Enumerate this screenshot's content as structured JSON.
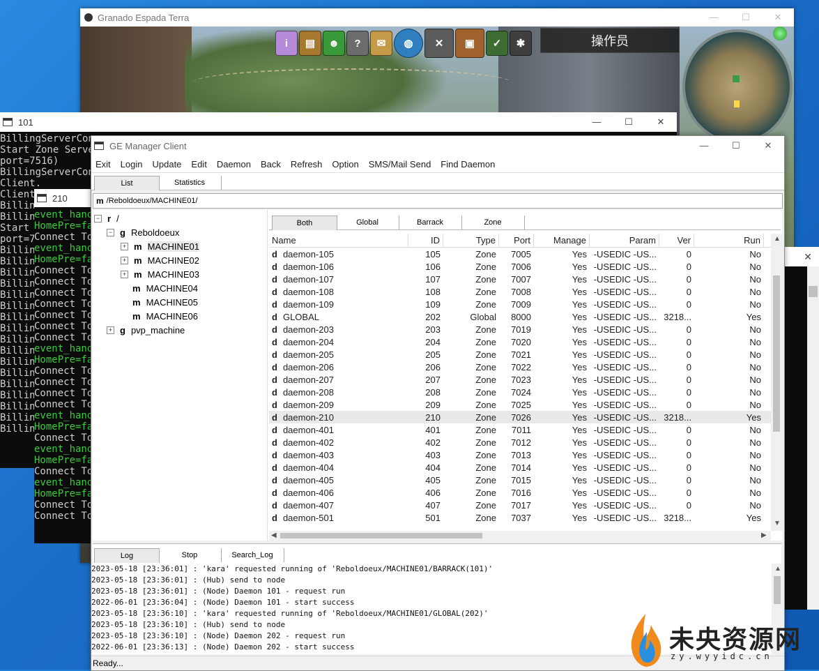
{
  "game_window": {
    "title": "Granado Espada Terra",
    "operator_label": "操作员"
  },
  "console_101": {
    "title": "101",
    "lines": [
      "BillingServerConn",
      "",
      "Start Zone Serve",
      "port=7516)",
      "BillingServerConn",
      "Client.",
      "Client.",
      "Billing",
      "Billing",
      "",
      "Start",
      "port=75",
      "Billing",
      "Billing",
      "Billing",
      "Billing",
      "Billing",
      "Billing",
      "Billing",
      "Billing",
      "Billing",
      "Billing",
      "Billing",
      "Billing",
      "Billing",
      "Billing",
      "Billing",
      "Billing",
      "Billing"
    ]
  },
  "console_210": {
    "title": "210",
    "lines": [
      {
        "text": "event_hand",
        "c": "g"
      },
      {
        "text": "HomePre=fa",
        "c": "g"
      },
      {
        "text": "Connect To",
        "c": "w"
      },
      {
        "text": "",
        "c": "w"
      },
      {
        "text": "event_hand",
        "c": "g"
      },
      {
        "text": "HomePre=fa",
        "c": "g"
      },
      {
        "text": "Connect To",
        "c": "w"
      },
      {
        "text": "Connect To",
        "c": "w"
      },
      {
        "text": "Connect To",
        "c": "w"
      },
      {
        "text": "Connect To",
        "c": "w"
      },
      {
        "text": "Connect To",
        "c": "w"
      },
      {
        "text": "Connect To",
        "c": "w"
      },
      {
        "text": "Connect To",
        "c": "w"
      },
      {
        "text": "event_hand",
        "c": "g"
      },
      {
        "text": "HomePre=fa",
        "c": "g"
      },
      {
        "text": "Connect To",
        "c": "w"
      },
      {
        "text": "Connect To",
        "c": "w"
      },
      {
        "text": "Connect To",
        "c": "w"
      },
      {
        "text": "Connect To",
        "c": "w"
      },
      {
        "text": "event_hand",
        "c": "g"
      },
      {
        "text": "HomePre=fa",
        "c": "g"
      },
      {
        "text": "Connect To",
        "c": "w"
      },
      {
        "text": "event_hand",
        "c": "g"
      },
      {
        "text": "HomePre=fa",
        "c": "g"
      },
      {
        "text": "Connect To",
        "c": "w"
      },
      {
        "text": "event_hand",
        "c": "g"
      },
      {
        "text": "HomePre=fa",
        "c": "g"
      },
      {
        "text": "Connect To",
        "c": "w"
      },
      {
        "text": "Connect To",
        "c": "w"
      }
    ]
  },
  "manager": {
    "title": "GE Manager Client",
    "menu": [
      "Exit",
      "Login",
      "Update",
      "Edit",
      "Daemon",
      "Back",
      "Refresh",
      "Option",
      "SMS/Mail Send",
      "Find Daemon"
    ],
    "tabs": [
      "List",
      "Statistics"
    ],
    "path_prefix": "m",
    "path": "/Reboldoeux/MACHINE01/",
    "tree": {
      "root_prefix": "r",
      "root": "/",
      "group_prefix": "g",
      "machine_prefix": "m",
      "group": "Reboldoeux",
      "machines": [
        "MACHINE01",
        "MACHINE02",
        "MACHINE03",
        "MACHINE04",
        "MACHINE05",
        "MACHINE06"
      ],
      "group2": "pvp_machine"
    },
    "list_tabs": [
      "Both",
      "Global",
      "Barrack",
      "Zone"
    ],
    "columns": [
      "Name",
      "ID",
      "Type",
      "Port",
      "Manage",
      "Param",
      "Ver",
      "Run"
    ],
    "row_prefix": "d",
    "rows": [
      [
        "daemon-105",
        "105",
        "Zone",
        "7005",
        "Yes",
        "-USEDIC -US...",
        "0",
        "No"
      ],
      [
        "daemon-106",
        "106",
        "Zone",
        "7006",
        "Yes",
        "-USEDIC -US...",
        "0",
        "No"
      ],
      [
        "daemon-107",
        "107",
        "Zone",
        "7007",
        "Yes",
        "-USEDIC -US...",
        "0",
        "No"
      ],
      [
        "daemon-108",
        "108",
        "Zone",
        "7008",
        "Yes",
        "-USEDIC -US...",
        "0",
        "No"
      ],
      [
        "daemon-109",
        "109",
        "Zone",
        "7009",
        "Yes",
        "-USEDIC -US...",
        "0",
        "No"
      ],
      [
        "GLOBAL",
        "202",
        "Global",
        "8000",
        "Yes",
        "-USEDIC -US...",
        "3218...",
        "Yes"
      ],
      [
        "daemon-203",
        "203",
        "Zone",
        "7019",
        "Yes",
        "-USEDIC -US...",
        "0",
        "No"
      ],
      [
        "daemon-204",
        "204",
        "Zone",
        "7020",
        "Yes",
        "-USEDIC -US...",
        "0",
        "No"
      ],
      [
        "daemon-205",
        "205",
        "Zone",
        "7021",
        "Yes",
        "-USEDIC -US...",
        "0",
        "No"
      ],
      [
        "daemon-206",
        "206",
        "Zone",
        "7022",
        "Yes",
        "-USEDIC -US...",
        "0",
        "No"
      ],
      [
        "daemon-207",
        "207",
        "Zone",
        "7023",
        "Yes",
        "-USEDIC -US...",
        "0",
        "No"
      ],
      [
        "daemon-208",
        "208",
        "Zone",
        "7024",
        "Yes",
        "-USEDIC -US...",
        "0",
        "No"
      ],
      [
        "daemon-209",
        "209",
        "Zone",
        "7025",
        "Yes",
        "-USEDIC -US...",
        "0",
        "No"
      ],
      [
        "daemon-210",
        "210",
        "Zone",
        "7026",
        "Yes",
        "-USEDIC -US...",
        "3218...",
        "Yes"
      ],
      [
        "daemon-401",
        "401",
        "Zone",
        "7011",
        "Yes",
        "-USEDIC -US...",
        "0",
        "No"
      ],
      [
        "daemon-402",
        "402",
        "Zone",
        "7012",
        "Yes",
        "-USEDIC -US...",
        "0",
        "No"
      ],
      [
        "daemon-403",
        "403",
        "Zone",
        "7013",
        "Yes",
        "-USEDIC -US...",
        "0",
        "No"
      ],
      [
        "daemon-404",
        "404",
        "Zone",
        "7014",
        "Yes",
        "-USEDIC -US...",
        "0",
        "No"
      ],
      [
        "daemon-405",
        "405",
        "Zone",
        "7015",
        "Yes",
        "-USEDIC -US...",
        "0",
        "No"
      ],
      [
        "daemon-406",
        "406",
        "Zone",
        "7016",
        "Yes",
        "-USEDIC -US...",
        "0",
        "No"
      ],
      [
        "daemon-407",
        "407",
        "Zone",
        "7017",
        "Yes",
        "-USEDIC -US...",
        "0",
        "No"
      ],
      [
        "daemon-501",
        "501",
        "Zone",
        "7037",
        "Yes",
        "-USEDIC -US...",
        "3218...",
        "Yes"
      ]
    ],
    "log_tabs": [
      "Log",
      "Stop",
      "Search_Log"
    ],
    "log": [
      "2023-05-18 [23:36:01] : 'kara' requested running of 'Reboldoeux/MACHINE01/BARRACK(101)'",
      "2023-05-18 [23:36:01] : (Hub) send to node",
      "2023-05-18 [23:36:01] : (Node) Daemon 101 - request run",
      "2022-06-01 [23:36:04] : (Node) Daemon 101 - start success",
      "2023-05-18 [23:36:10] : 'kara' requested running of 'Reboldoeux/MACHINE01/GLOBAL(202)'",
      "2023-05-18 [23:36:10] : (Hub) send to node",
      "2023-05-18 [23:36:10] : (Node) Daemon 202 - request run",
      "2022-06-01 [23:36:13] : (Node) Daemon 202 - start success"
    ],
    "status": "Ready..."
  },
  "watermark": {
    "text": "未央资源网",
    "sub": "zy.wyyidc.cn"
  },
  "colors": {
    "desktop": "#1f7fd6",
    "console_green": "#3cc83c",
    "selected_row": "#e9e9e9"
  }
}
